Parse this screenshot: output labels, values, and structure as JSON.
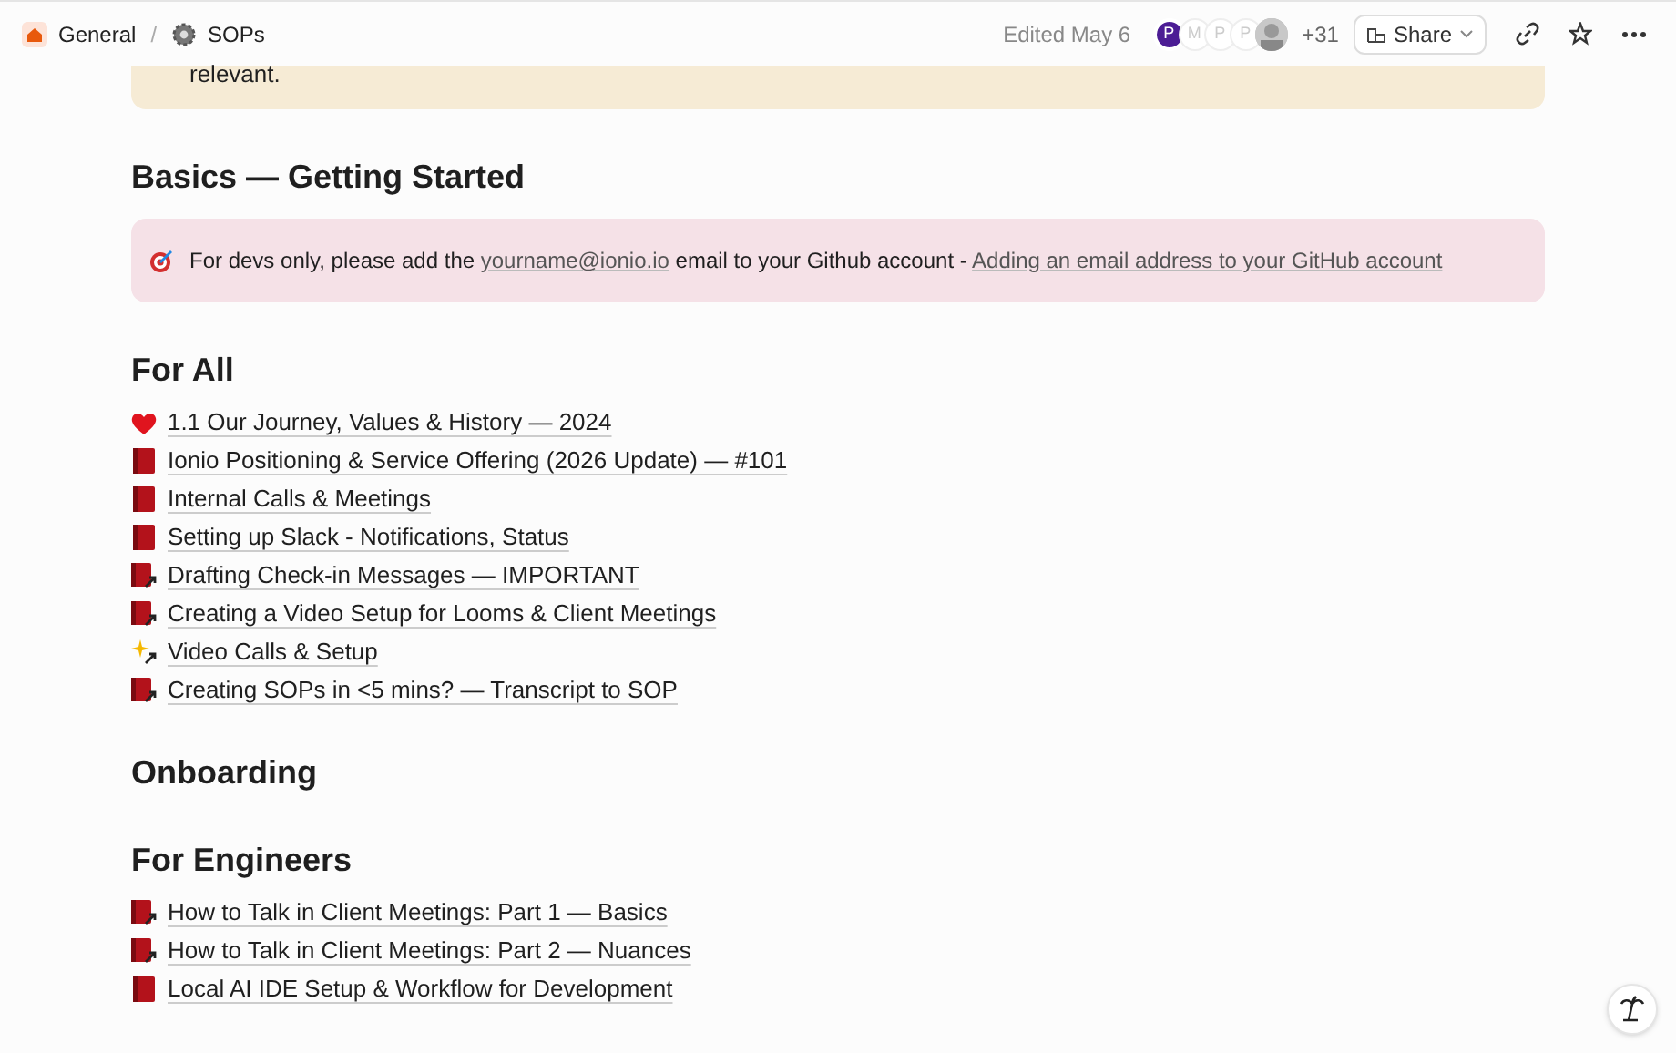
{
  "breadcrumb": [
    {
      "label": "General",
      "kind": "home"
    },
    {
      "label": "SOPs",
      "kind": "gear"
    }
  ],
  "breadcrumb_separator": "/",
  "top_bar": {
    "edited": "Edited May 6",
    "avatars": [
      {
        "letter": "P",
        "kind": "filled"
      },
      {
        "letter": "M",
        "kind": "faded"
      },
      {
        "letter": "P",
        "kind": "faded"
      },
      {
        "letter": "P",
        "kind": "faded"
      },
      {
        "kind": "picture"
      }
    ],
    "more_count": "+31",
    "share": "Share"
  },
  "top_callout": {
    "text": "relevant."
  },
  "sections": [
    {
      "heading": "Basics — Getting Started",
      "callout": {
        "segments": [
          {
            "kind": "text",
            "text": "For devs only, please add the "
          },
          {
            "kind": "link",
            "text": "yourname@ionio.io"
          },
          {
            "kind": "text",
            "text": " email to your Github account - "
          },
          {
            "kind": "link",
            "text": "Adding an email address to your GitHub account"
          }
        ]
      }
    },
    {
      "heading": "For All",
      "items": [
        {
          "kind": "heart",
          "label": "1.1 Our Journey, Values & History — 2024"
        },
        {
          "kind": "book",
          "label": "Ionio Positioning & Service Offering (2026 Update) — #101"
        },
        {
          "kind": "book",
          "label": "Internal Calls & Meetings"
        },
        {
          "kind": "book",
          "label": "Setting up Slack - Notifications, Status"
        },
        {
          "kind": "book-link",
          "label": "Drafting Check-in Messages — IMPORTANT"
        },
        {
          "kind": "book-link",
          "label": "Creating a Video Setup for Looms & Client Meetings"
        },
        {
          "kind": "sparkle-link",
          "label": "Video Calls & Setup"
        },
        {
          "kind": "book-link",
          "label": "Creating SOPs in <5 mins? — Transcript to SOP"
        }
      ]
    },
    {
      "heading": "Onboarding"
    },
    {
      "heading": "For Engineers",
      "items": [
        {
          "kind": "book-link",
          "label": "How to Talk in Client Meetings: Part 1 — Basics"
        },
        {
          "kind": "book-link",
          "label": "How to Talk in Client Meetings: Part 2 — Nuances"
        },
        {
          "kind": "book",
          "label": "Local AI IDE Setup & Workflow for Development"
        }
      ]
    }
  ]
}
